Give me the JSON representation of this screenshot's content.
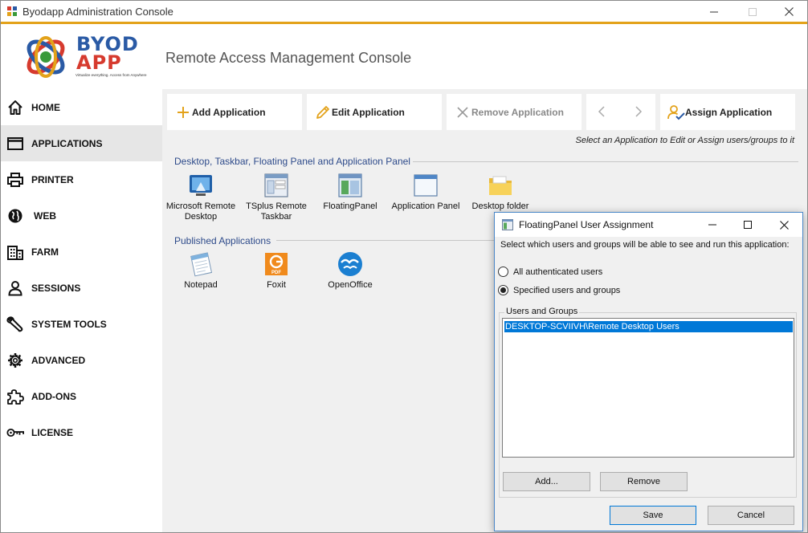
{
  "window": {
    "title": "Byodapp Administration Console",
    "subtitle": "Remote Access Management Console"
  },
  "logo": {
    "line1": "BYOD",
    "line2": "APP",
    "tagline": "Virtualize everything. Access from Anywhere"
  },
  "sidebar": {
    "items": [
      {
        "label": "HOME",
        "icon": "home-icon"
      },
      {
        "label": "APPLICATIONS",
        "icon": "window-icon",
        "active": true
      },
      {
        "label": "PRINTER",
        "icon": "printer-icon"
      },
      {
        "label": "WEB",
        "icon": "globe-icon"
      },
      {
        "label": "FARM",
        "icon": "building-icon"
      },
      {
        "label": "SESSIONS",
        "icon": "user-icon"
      },
      {
        "label": "SYSTEM TOOLS",
        "icon": "wrench-icon"
      },
      {
        "label": "ADVANCED",
        "icon": "gear-icon"
      },
      {
        "label": "ADD-ONS",
        "icon": "puzzle-icon"
      },
      {
        "label": "LICENSE",
        "icon": "key-icon"
      }
    ]
  },
  "toolbar": {
    "add": "Add Application",
    "edit": "Edit Application",
    "remove": "Remove Application",
    "assign": "Assign Application",
    "hint": "Select an Application to Edit or Assign users/groups to it"
  },
  "sections": {
    "desktop": "Desktop, Taskbar, Floating Panel and Application Panel",
    "published": "Published Applications"
  },
  "desktop_apps": [
    {
      "label": "Microsoft Remote Desktop",
      "icon": "remote-desktop-icon"
    },
    {
      "label": "TSplus Remote Taskbar",
      "icon": "taskbar-icon"
    },
    {
      "label": "FloatingPanel",
      "icon": "floating-panel-icon"
    },
    {
      "label": "Application Panel",
      "icon": "application-panel-icon"
    },
    {
      "label": "Desktop folder",
      "icon": "folder-icon"
    }
  ],
  "published_apps": [
    {
      "label": "Notepad",
      "icon": "notepad-icon"
    },
    {
      "label": "Foxit",
      "icon": "foxit-icon"
    },
    {
      "label": "OpenOffice",
      "icon": "openoffice-icon"
    }
  ],
  "dialog": {
    "title": "FloatingPanel User Assignment",
    "description": "Select which users and groups will be able to see and run this application:",
    "radio_all": "All authenticated users",
    "radio_specified": "Specified users and groups",
    "selected_option": "Specified users and groups",
    "group_label": "Users and Groups",
    "list_items": [
      "DESKTOP-SCVIIVH\\Remote Desktop Users"
    ],
    "add_button": "Add...",
    "remove_button": "Remove",
    "save_button": "Save",
    "cancel_button": "Cancel"
  },
  "colors": {
    "accent_orange": "#e3a21a",
    "section_blue": "#2d4a8a",
    "selection_blue": "#0078d7"
  }
}
